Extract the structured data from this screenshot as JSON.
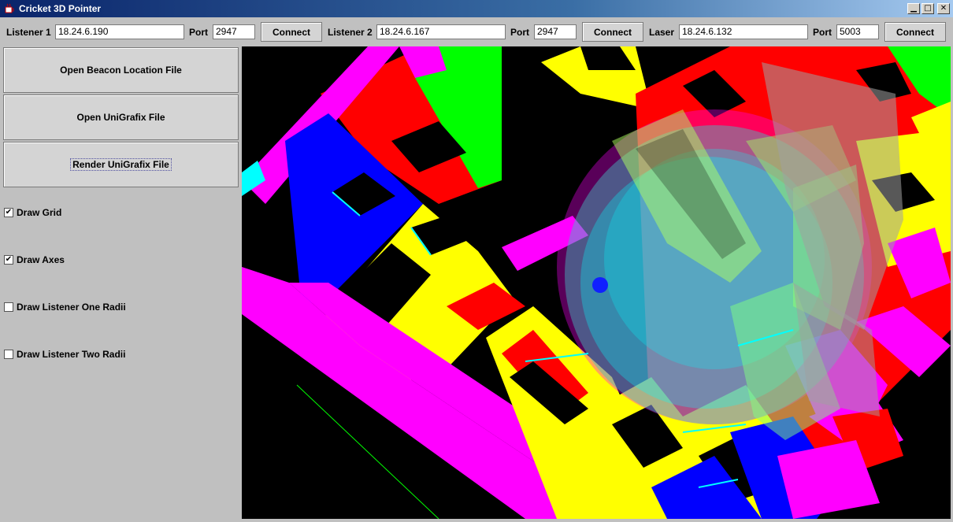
{
  "window": {
    "title": "Cricket 3D Pointer",
    "minimize": "▁",
    "maximize": "□",
    "close": "✕",
    "icon": "java-cup-icon"
  },
  "toolbar": {
    "listener1": {
      "label": "Listener 1",
      "ip": "18.24.6.190",
      "port_label": "Port",
      "port": "2947",
      "connect": "Connect"
    },
    "listener2": {
      "label": "Listener 2",
      "ip": "18.24.6.167",
      "port_label": "Port",
      "port": "2947",
      "connect": "Connect"
    },
    "laser": {
      "label": "Laser",
      "ip": "18.24.6.132",
      "port_label": "Port",
      "port": "5003",
      "connect": "Connect"
    }
  },
  "panel": {
    "open_beacon": "Open Beacon Location File",
    "open_unigrafix": "Open UniGrafix File",
    "render_unigrafix": "Render UniGrafix File",
    "checkboxes": [
      {
        "label": "Draw Grid",
        "checked": true,
        "mark": "✔"
      },
      {
        "label": "Draw Axes",
        "checked": true,
        "mark": "✔"
      },
      {
        "label": "Draw Listener One Radii",
        "checked": false,
        "mark": ""
      },
      {
        "label": "Draw Listener Two Radii",
        "checked": false,
        "mark": ""
      }
    ]
  },
  "colors": {
    "magenta": "#ff00ff",
    "yellow": "#ffff00",
    "red": "#ff0000",
    "green": "#00ff00",
    "blue": "#0000ff",
    "cyan": "#00ffff",
    "sphere_cyan": "#40e0e0",
    "sphere_magenta": "#c070ff"
  }
}
